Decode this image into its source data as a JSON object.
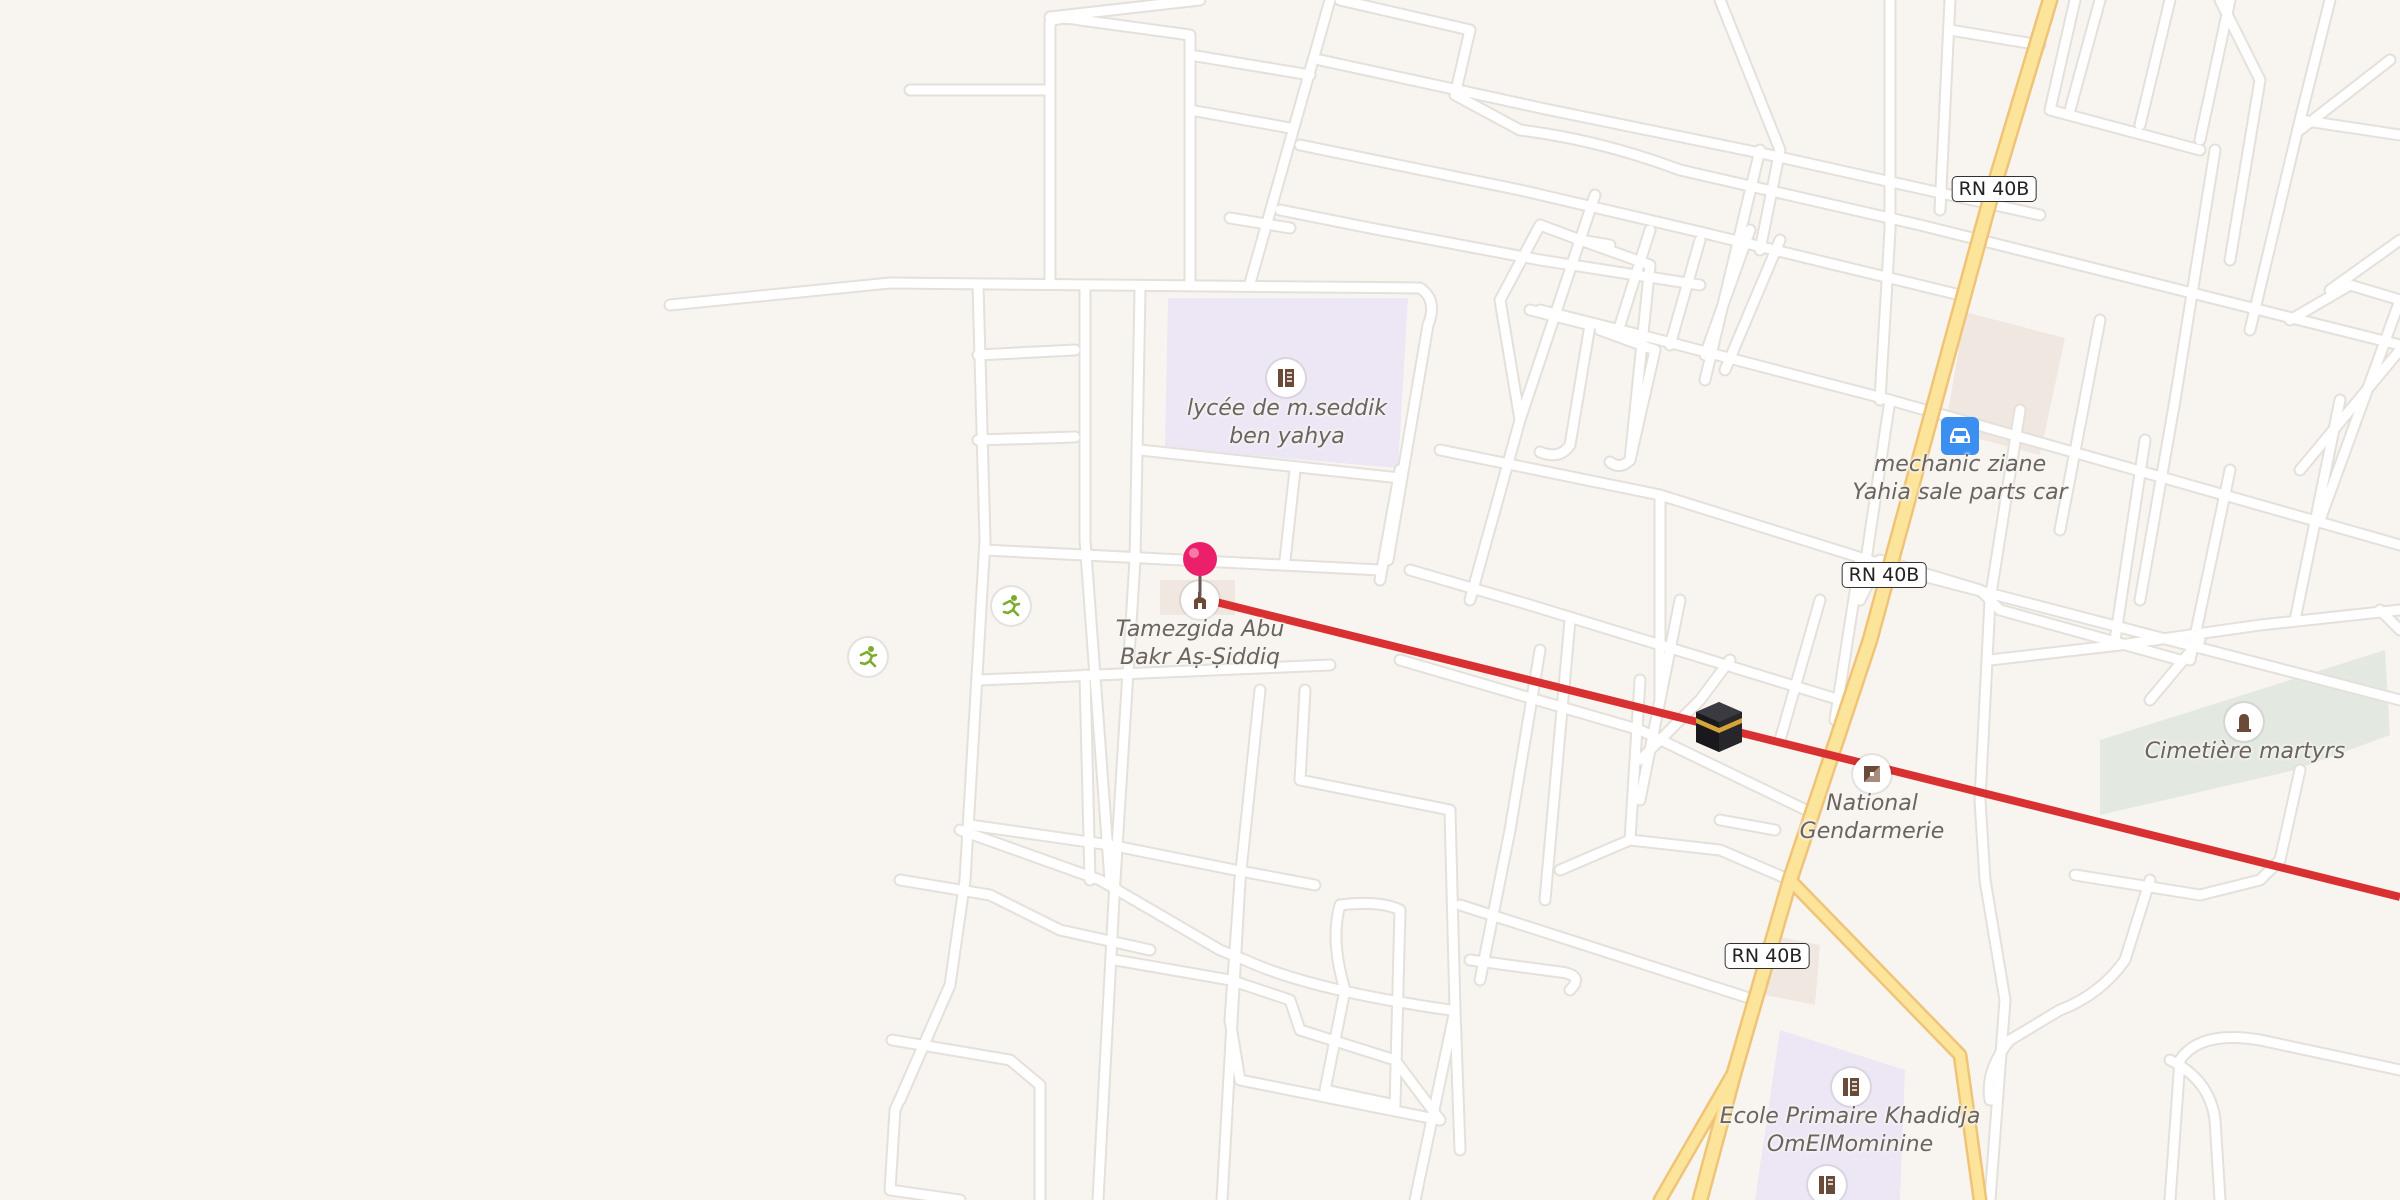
{
  "colors": {
    "land": "#f8f5f1",
    "road": "#ffffff",
    "road_casing": "#e4e0da",
    "trunk": "#fde49b",
    "trunk_casing": "#efc477",
    "school_area": "#ede6f5",
    "cemetery_area": "#e3e9e1",
    "building": "#efe7e0",
    "qibla_line": "#d93131",
    "pin": "#ec1f6a"
  },
  "road_refs": [
    "RN 40B",
    "RN 40B",
    "RN 40B"
  ],
  "places": [
    {
      "name": "lycée de m.seddik ben yahya",
      "lines": [
        "lycée de m.seddik",
        "ben yahya"
      ],
      "icon": "school-icon"
    },
    {
      "name": "Tamezgida Abu Bakr Aṣ-Ṣiddiq",
      "lines": [
        "Tamezgida Abu",
        "Bakr Aṣ-Ṣiddiq"
      ],
      "icon": "mosque-icon"
    },
    {
      "name": "mechanic ziane Yahia sale parts car",
      "lines": [
        "mechanic ziane",
        "Yahia sale parts car"
      ],
      "icon": "car-icon"
    },
    {
      "name": "National Gendarmerie",
      "lines": [
        "National",
        "Gendarmerie"
      ],
      "icon": "police-icon"
    },
    {
      "name": "Cimetière martyrs",
      "lines": [
        "Cimetière martyrs"
      ],
      "icon": "cemetery-icon"
    },
    {
      "name": "Ecole Primaire Khadidja OmElMominine",
      "lines": [
        "Ecole Primaire Khadidja",
        "OmElMominine"
      ],
      "icon": "school-icon"
    }
  ],
  "icons": {
    "sport_poi": "running-icon",
    "kaaba_marker": "kaaba-icon",
    "location_pin": "map-pin-icon",
    "qibla_line": "qibla-direction-line"
  }
}
